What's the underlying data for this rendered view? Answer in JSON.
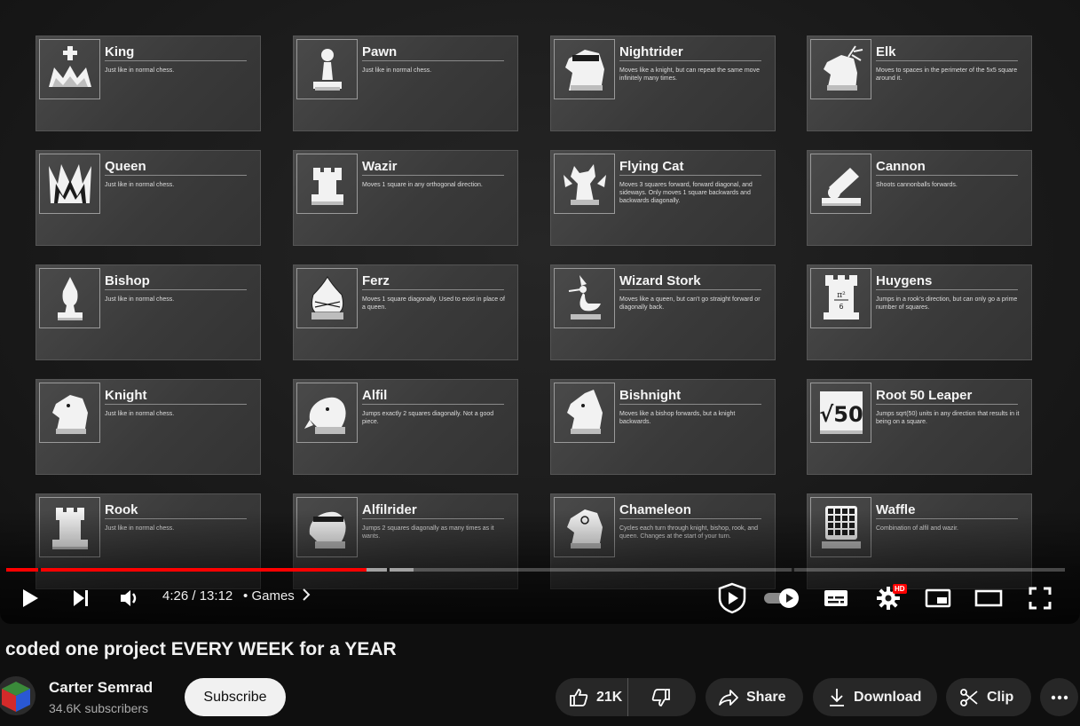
{
  "player": {
    "time_current": "4:26",
    "time_separator": "/",
    "time_total": "13:12",
    "chapter": "Games",
    "progress_played": 0.34,
    "progress_buffered": 0.385,
    "hd_badge": "HD",
    "accent_color": "#ff0000"
  },
  "cards": [
    {
      "name": "King",
      "desc": "Just like in normal chess.",
      "icon": "king-icon"
    },
    {
      "name": "Pawn",
      "desc": "Just like in normal chess.",
      "icon": "pawn-icon"
    },
    {
      "name": "Nightrider",
      "desc": "Moves like a knight, but can repeat the same move infinitely many times.",
      "icon": "nightrider-icon"
    },
    {
      "name": "Elk",
      "desc": "Moves to spaces in the perimeter of the 5x5 square around it.",
      "icon": "elk-icon"
    },
    {
      "name": "Queen",
      "desc": "Just like in normal chess.",
      "icon": "queen-icon"
    },
    {
      "name": "Wazir",
      "desc": "Moves 1 square in any orthogonal direction.",
      "icon": "wazir-icon"
    },
    {
      "name": "Flying Cat",
      "desc": "Moves 3 squares forward, forward diagonal, and sideways. Only moves 1 square backwards and backwards diagonally.",
      "icon": "flying-cat-icon"
    },
    {
      "name": "Cannon",
      "desc": "Shoots cannonballs forwards.",
      "icon": "cannon-icon"
    },
    {
      "name": "Bishop",
      "desc": "Just like in normal chess.",
      "icon": "bishop-icon"
    },
    {
      "name": "Ferz",
      "desc": "Moves 1 square diagonally. Used to exist in place of a queen.",
      "icon": "ferz-icon"
    },
    {
      "name": "Wizard Stork",
      "desc": "Moves like a queen, but can't go straight forward or diagonally back.",
      "icon": "wizard-stork-icon"
    },
    {
      "name": "Huygens",
      "desc": "Jumps in a rook's direction, but can only go a prime number of squares.",
      "icon": "huygens-icon"
    },
    {
      "name": "Knight",
      "desc": "Just like in normal chess.",
      "icon": "knight-icon"
    },
    {
      "name": "Alfil",
      "desc": "Jumps exactly 2 squares diagonally. Not a good piece.",
      "icon": "alfil-icon"
    },
    {
      "name": "Bishnight",
      "desc": "Moves like a bishop forwards, but a knight backwards.",
      "icon": "bishnight-icon"
    },
    {
      "name": "Root 50 Leaper",
      "desc": "Jumps sqrt(50) units in any direction that results in it being on a square.",
      "icon": "root-50-leaper-icon",
      "glyph": "√50"
    },
    {
      "name": "Rook",
      "desc": "Just like in normal chess.",
      "icon": "rook-icon"
    },
    {
      "name": "Alfilrider",
      "desc": "Jumps 2 squares diagonally as many times as it wants.",
      "icon": "alfilrider-icon"
    },
    {
      "name": "Chameleon",
      "desc": "Cycles each turn through knight, bishop, rook, and queen. Changes at the start of your turn.",
      "icon": "chameleon-icon"
    },
    {
      "name": "Waffle",
      "desc": "Combination of alfil and wazir.",
      "icon": "waffle-icon"
    }
  ],
  "huygens_glyph": {
    "top": "π²",
    "bottom": "6"
  },
  "video": {
    "title": "coded one project EVERY WEEK for a YEAR",
    "channel": "Carter Semrad",
    "subscribers": "34.6K subscribers",
    "subscribe_label": "Subscribe",
    "likes": "21K",
    "share_label": "Share",
    "download_label": "Download",
    "clip_label": "Clip"
  }
}
